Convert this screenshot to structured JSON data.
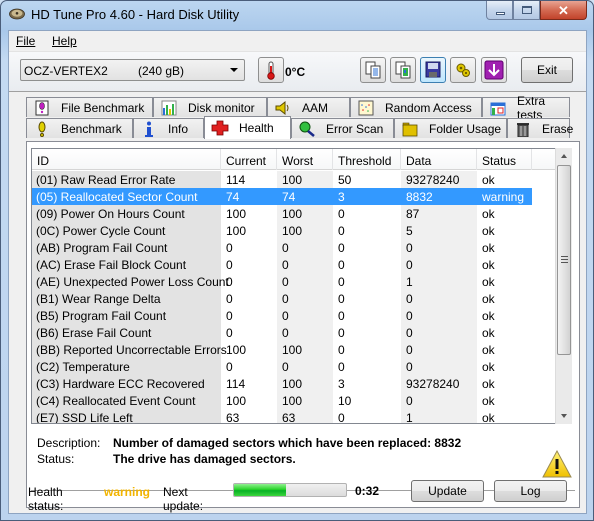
{
  "window": {
    "title": "HD Tune Pro 4.60 - Hard Disk Utility",
    "controls": [
      "minimize",
      "maximize",
      "close"
    ]
  },
  "menu": {
    "file": "File",
    "help": "Help"
  },
  "toolbar": {
    "drive_name": "OCZ-VERTEX2",
    "drive_size": "(240 gB)",
    "temperature": "0°C",
    "icons": [
      "copy-text-icon",
      "copy-screenshot-icon",
      "save-icon",
      "options-icon",
      "download-icon"
    ],
    "exit_label": "Exit"
  },
  "tabs": {
    "row1": [
      {
        "label": "File Benchmark",
        "icon": "file-benchmark-icon"
      },
      {
        "label": "Disk monitor",
        "icon": "disk-monitor-icon"
      },
      {
        "label": "AAM",
        "icon": "speaker-icon"
      },
      {
        "label": "Random Access",
        "icon": "random-access-icon"
      },
      {
        "label": "Extra tests",
        "icon": "extra-tests-icon"
      }
    ],
    "row2": [
      {
        "label": "Benchmark",
        "icon": "benchmark-icon"
      },
      {
        "label": "Info",
        "icon": "info-icon"
      },
      {
        "label": "Health",
        "icon": "health-cross-icon",
        "selected": true
      },
      {
        "label": "Error Scan",
        "icon": "magnifier-icon"
      },
      {
        "label": "Folder Usage",
        "icon": "folder-icon"
      },
      {
        "label": "Erase",
        "icon": "trash-icon"
      }
    ]
  },
  "smart_table": {
    "columns": [
      "ID",
      "Current",
      "Worst",
      "Threshold",
      "Data",
      "Status"
    ],
    "selected_row": 1,
    "rows": [
      [
        "(01) Raw Read Error Rate",
        "114",
        "100",
        "50",
        "93278240",
        "ok"
      ],
      [
        "(05) Reallocated Sector Count",
        "74",
        "74",
        "3",
        "8832",
        "warning"
      ],
      [
        "(09) Power On Hours Count",
        "100",
        "100",
        "0",
        "87",
        "ok"
      ],
      [
        "(0C) Power Cycle Count",
        "100",
        "100",
        "0",
        "5",
        "ok"
      ],
      [
        "(AB) Program Fail Count",
        "0",
        "0",
        "0",
        "0",
        "ok"
      ],
      [
        "(AC) Erase Fail Block Count",
        "0",
        "0",
        "0",
        "0",
        "ok"
      ],
      [
        "(AE) Unexpected Power Loss Count",
        "0",
        "0",
        "0",
        "1",
        "ok"
      ],
      [
        "(B1) Wear Range Delta",
        "0",
        "0",
        "0",
        "0",
        "ok"
      ],
      [
        "(B5) Program Fail Count",
        "0",
        "0",
        "0",
        "0",
        "ok"
      ],
      [
        "(B6) Erase Fail Count",
        "0",
        "0",
        "0",
        "0",
        "ok"
      ],
      [
        "(BB) Reported Uncorrectable Errors",
        "100",
        "100",
        "0",
        "0",
        "ok"
      ],
      [
        "(C2) Temperature",
        "0",
        "0",
        "0",
        "0",
        "ok"
      ],
      [
        "(C3) Hardware ECC Recovered",
        "114",
        "100",
        "3",
        "93278240",
        "ok"
      ],
      [
        "(C4) Reallocated Event Count",
        "100",
        "100",
        "10",
        "0",
        "ok"
      ],
      [
        "(E7) SSD Life Left",
        "63",
        "63",
        "0",
        "1",
        "ok"
      ]
    ]
  },
  "details": {
    "description_label": "Description:",
    "description_value": "Number of damaged sectors which have been replaced: 8832",
    "status_label": "Status:",
    "status_value": "The drive has damaged sectors.",
    "icon": "warning-triangle-icon"
  },
  "footer": {
    "health_label": "Health status:",
    "health_value": "warning",
    "health_color": "#f2b400",
    "next_update_label": "Next update:",
    "next_update_progress": 0.46,
    "timer": "0:32",
    "update_label": "Update",
    "log_label": "Log"
  },
  "colors": {
    "selection": "#3399ff",
    "id_column_bg": "#e3e3e3",
    "alt_column_bg": "#f0f0f0"
  }
}
